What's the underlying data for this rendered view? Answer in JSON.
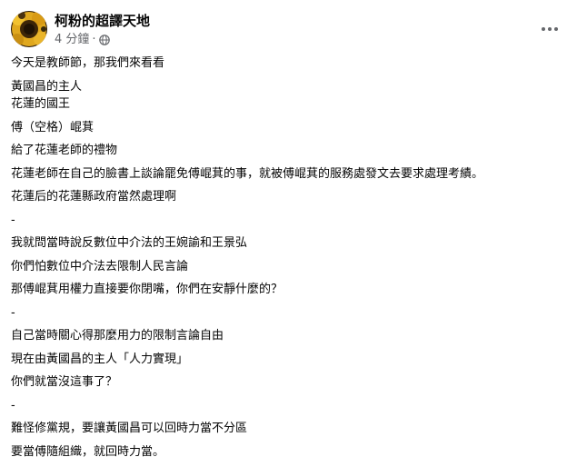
{
  "header": {
    "page_name": "柯粉的超譯天地",
    "timestamp": "4 分鐘",
    "dot": "·",
    "privacy_icon": "globe-icon",
    "more_icon": "more-horizontal-icon"
  },
  "post": {
    "paragraphs": [
      [
        "今天是教師節，那我們來看看"
      ],
      [
        "黃國昌的主人",
        "花蓮的國王"
      ],
      [
        "傅（空格）崐萁"
      ],
      [
        "給了花蓮老師的禮物"
      ],
      [
        "花蓮老師在自己的臉書上談論罷免傅崐萁的事，就被傅崐萁的服務處發文去要求處理考績。"
      ],
      [
        "花蓮后的花蓮縣政府當然處理啊"
      ],
      [
        "-"
      ],
      [
        "我就問當時說反數位中介法的王婉諭和王景弘"
      ],
      [
        "你們怕數位中介法去限制人民言論"
      ],
      [
        "那傅崐萁用權力直接要你閉嘴，你們在安靜什麼的？"
      ],
      [
        "-"
      ],
      [
        "自己當時關心得那麼用力的限制言論自由"
      ],
      [
        "現在由黃國昌的主人「人力實現」"
      ],
      [
        "你們就當沒這事了？"
      ],
      [
        "-"
      ],
      [
        "難怪修黨規，要讓黃國昌可以回時力當不分區"
      ],
      [
        "要當傅隨組織，就回時力當。"
      ]
    ]
  },
  "colors": {
    "text": "#050505",
    "secondary_text": "#65676b",
    "background": "#ffffff"
  }
}
